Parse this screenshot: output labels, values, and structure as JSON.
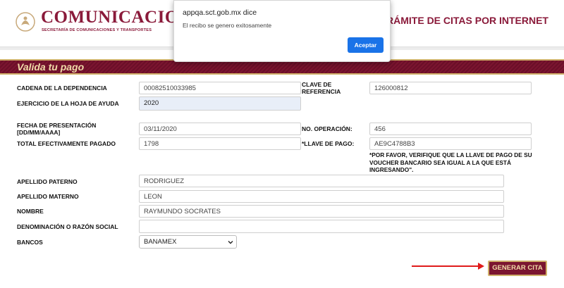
{
  "header": {
    "brand_title": "COMUNICACIONES",
    "brand_subtitle": "SECRETARÍA DE COMUNICACIONES Y TRANSPORTES",
    "right_title": "TRÁMITE DE CITAS POR INTERNET"
  },
  "section": {
    "title": "Valida tu pago"
  },
  "form": {
    "dependencia_label": "CADENA DE LA DEPENDENCIA",
    "dependencia_value": "00082510033985",
    "clave_ref_label": "CLAVE DE REFERENCIA",
    "clave_ref_value": "126000812",
    "ejercicio_label": "EJERCICIO DE LA HOJA DE AYUDA",
    "ejercicio_value": "2020",
    "fecha_label": "FECHA DE PRESENTACIÓN [DD/MM/AAAA]",
    "fecha_value": "03/11/2020",
    "operacion_label": "NO. OPERACIÓN:",
    "operacion_value": "456",
    "total_label": "TOTAL EFECTIVAMENTE PAGADO",
    "total_value": "1798",
    "llave_label": "*LLAVE DE PAGO:",
    "llave_value": "AE9C4788B3",
    "llave_note": "*POR FAVOR, VERIFIQUE QUE LA LLAVE DE PAGO DE SU VOUCHER BANCARIO SEA IGUAL A LA QUE ESTÁ INGRESANDO\".",
    "paterno_label": "APELLIDO PATERNO",
    "paterno_value": "RODRIGUEZ",
    "materno_label": "APELLIDO MATERNO",
    "materno_value": "LEON",
    "nombre_label": "NOMBRE",
    "nombre_value": "RAYMUNDO SOCRATES",
    "razon_label": "DENOMINACIÓN O RAZÓN SOCIAL",
    "razon_value": "",
    "bancos_label": "BANCOS",
    "bancos_value": "BANAMEX"
  },
  "actions": {
    "generate_label": "GENERAR CITA"
  },
  "dialog": {
    "host": "appqa.sct.gob.mx dice",
    "message": "El recibo se genero exitosamente",
    "ok_label": "Aceptar"
  },
  "colors": {
    "brand": "#8a1a3a",
    "gold": "#cfb06a",
    "dialog_button": "#1a73e8"
  }
}
